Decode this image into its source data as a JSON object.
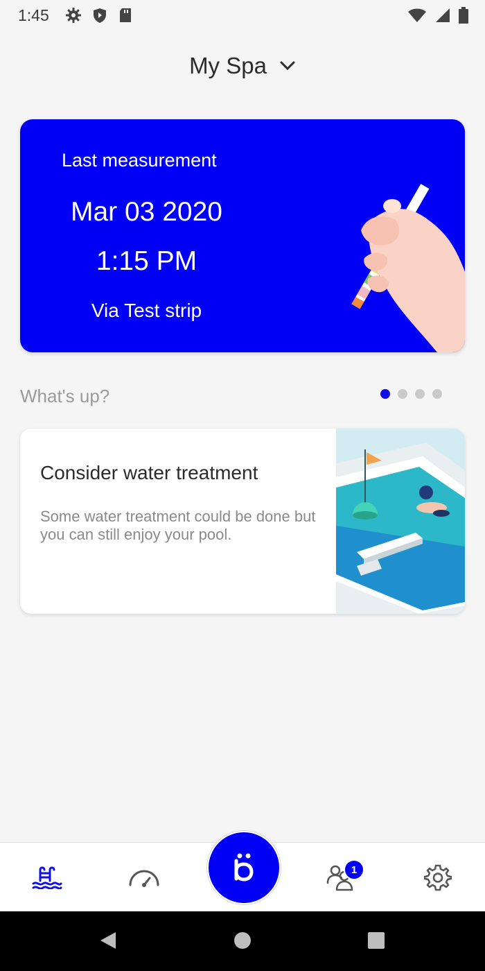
{
  "status_bar": {
    "time": "1:45",
    "left_icons": [
      "gear-icon",
      "shield-icon",
      "sd-card-icon"
    ],
    "right_icons": [
      "wifi-icon",
      "signal-icon",
      "battery-icon"
    ]
  },
  "header": {
    "title": "My Spa",
    "dropdown_icon": "chevron-down-icon"
  },
  "measurement_card": {
    "label": "Last measurement",
    "date": "Mar 03 2020",
    "time": "1:15 PM",
    "via": "Via Test strip",
    "bg_color": "#0000f5"
  },
  "whats_up": {
    "label": "What's up?",
    "page_count": 4,
    "active_page": 1
  },
  "tip_card": {
    "title": "Consider water treatment",
    "body": "Some water treatment could be done but you can still enjoy your pool."
  },
  "bottom_nav": {
    "items": [
      {
        "name": "pool",
        "icon": "pool-ladder-icon",
        "active": true
      },
      {
        "name": "gauge",
        "icon": "gauge-icon",
        "active": false
      },
      {
        "name": "center",
        "icon": "b-logo-icon"
      },
      {
        "name": "community",
        "icon": "people-icon",
        "badge": "1"
      },
      {
        "name": "settings",
        "icon": "gear-icon",
        "active": false
      }
    ]
  },
  "colors": {
    "accent": "#0000f5",
    "background": "#f4f5f4"
  }
}
